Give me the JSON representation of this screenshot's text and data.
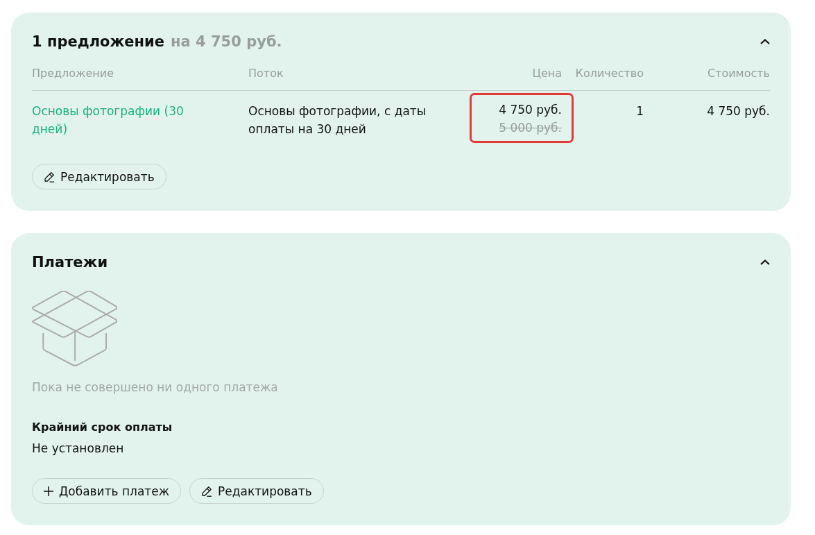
{
  "offers_section": {
    "title": "1 предложение",
    "subtitle": "на 4 750 руб.",
    "expanded": true,
    "table": {
      "columns": [
        "Предложение",
        "Поток",
        "Цена",
        "Количество",
        "Стоимость"
      ],
      "rows": [
        {
          "offer": "Основы фотографии (30 дней)",
          "stream": "Основы фотографии, с даты оплаты на 30 дней",
          "price": "4 750 руб.",
          "old_price": "5 000 руб.",
          "price_highlighted": true,
          "quantity": "1",
          "cost": "4 750 руб."
        }
      ]
    },
    "buttons": [
      {
        "kind": "edit",
        "label": "Редактировать"
      }
    ]
  },
  "payments_section": {
    "title": "Платежи",
    "expanded": true,
    "empty_message": "Пока не совершено ни одного платежа",
    "deadline": {
      "label": "Крайний срок оплаты",
      "value": "Не установлен"
    },
    "buttons": [
      {
        "kind": "add",
        "label": "Добавить платеж"
      },
      {
        "kind": "edit",
        "label": "Редактировать"
      }
    ]
  }
}
